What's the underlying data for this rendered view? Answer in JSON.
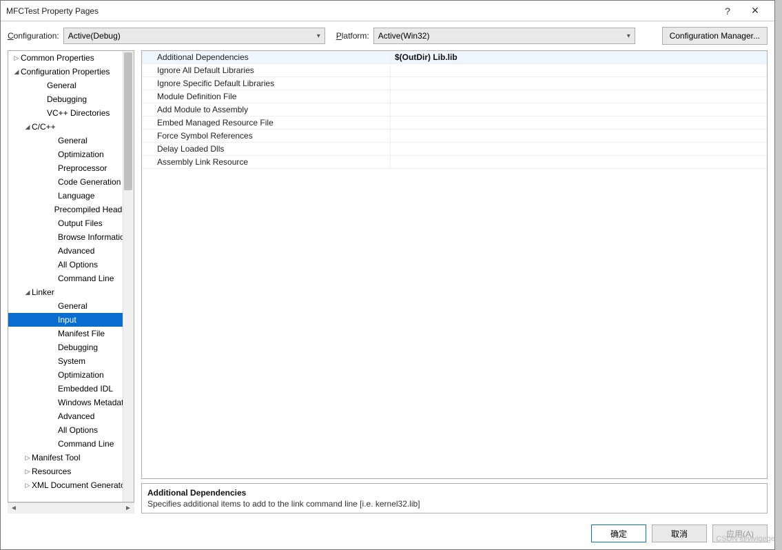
{
  "title": "MFCTest Property Pages",
  "toolbar": {
    "configuration_label": "Configuration:",
    "configuration_value": "Active(Debug)",
    "platform_label": "Platform:",
    "platform_value": "Active(Win32)",
    "config_manager": "Configuration Manager..."
  },
  "tree": [
    {
      "label": "Common Properties",
      "depth": 0,
      "tw": "▷"
    },
    {
      "label": "Configuration Properties",
      "depth": 0,
      "tw": "◢"
    },
    {
      "label": "General",
      "depth": 2,
      "tw": ""
    },
    {
      "label": "Debugging",
      "depth": 2,
      "tw": ""
    },
    {
      "label": "VC++ Directories",
      "depth": 2,
      "tw": ""
    },
    {
      "label": "C/C++",
      "depth": 1,
      "tw": "◢"
    },
    {
      "label": "General",
      "depth": 3,
      "tw": ""
    },
    {
      "label": "Optimization",
      "depth": 3,
      "tw": ""
    },
    {
      "label": "Preprocessor",
      "depth": 3,
      "tw": ""
    },
    {
      "label": "Code Generation",
      "depth": 3,
      "tw": ""
    },
    {
      "label": "Language",
      "depth": 3,
      "tw": ""
    },
    {
      "label": "Precompiled Headers",
      "depth": 3,
      "tw": ""
    },
    {
      "label": "Output Files",
      "depth": 3,
      "tw": ""
    },
    {
      "label": "Browse Information",
      "depth": 3,
      "tw": ""
    },
    {
      "label": "Advanced",
      "depth": 3,
      "tw": ""
    },
    {
      "label": "All Options",
      "depth": 3,
      "tw": ""
    },
    {
      "label": "Command Line",
      "depth": 3,
      "tw": ""
    },
    {
      "label": "Linker",
      "depth": 1,
      "tw": "◢"
    },
    {
      "label": "General",
      "depth": 3,
      "tw": ""
    },
    {
      "label": "Input",
      "depth": 3,
      "tw": "",
      "selected": true
    },
    {
      "label": "Manifest File",
      "depth": 3,
      "tw": ""
    },
    {
      "label": "Debugging",
      "depth": 3,
      "tw": ""
    },
    {
      "label": "System",
      "depth": 3,
      "tw": ""
    },
    {
      "label": "Optimization",
      "depth": 3,
      "tw": ""
    },
    {
      "label": "Embedded IDL",
      "depth": 3,
      "tw": ""
    },
    {
      "label": "Windows Metadata",
      "depth": 3,
      "tw": ""
    },
    {
      "label": "Advanced",
      "depth": 3,
      "tw": ""
    },
    {
      "label": "All Options",
      "depth": 3,
      "tw": ""
    },
    {
      "label": "Command Line",
      "depth": 3,
      "tw": ""
    },
    {
      "label": "Manifest Tool",
      "depth": 1,
      "tw": "▷"
    },
    {
      "label": "Resources",
      "depth": 1,
      "tw": "▷"
    },
    {
      "label": "XML Document Generator",
      "depth": 1,
      "tw": "▷"
    }
  ],
  "grid": [
    {
      "name": "Additional Dependencies",
      "value": "$(OutDir)     Lib.lib",
      "sel": true,
      "bold": true
    },
    {
      "name": "Ignore All Default Libraries",
      "value": ""
    },
    {
      "name": "Ignore Specific Default Libraries",
      "value": ""
    },
    {
      "name": "Module Definition File",
      "value": ""
    },
    {
      "name": "Add Module to Assembly",
      "value": ""
    },
    {
      "name": "Embed Managed Resource File",
      "value": ""
    },
    {
      "name": "Force Symbol References",
      "value": ""
    },
    {
      "name": "Delay Loaded Dlls",
      "value": ""
    },
    {
      "name": "Assembly Link Resource",
      "value": ""
    }
  ],
  "desc": {
    "title": "Additional Dependencies",
    "body": "Specifies additional items to add to the link command line [i.e. kernel32.lib]"
  },
  "buttons": {
    "ok": "确定",
    "cancel": "取消",
    "apply": "应用(A)"
  },
  "watermark": "CSDN @vivigege"
}
